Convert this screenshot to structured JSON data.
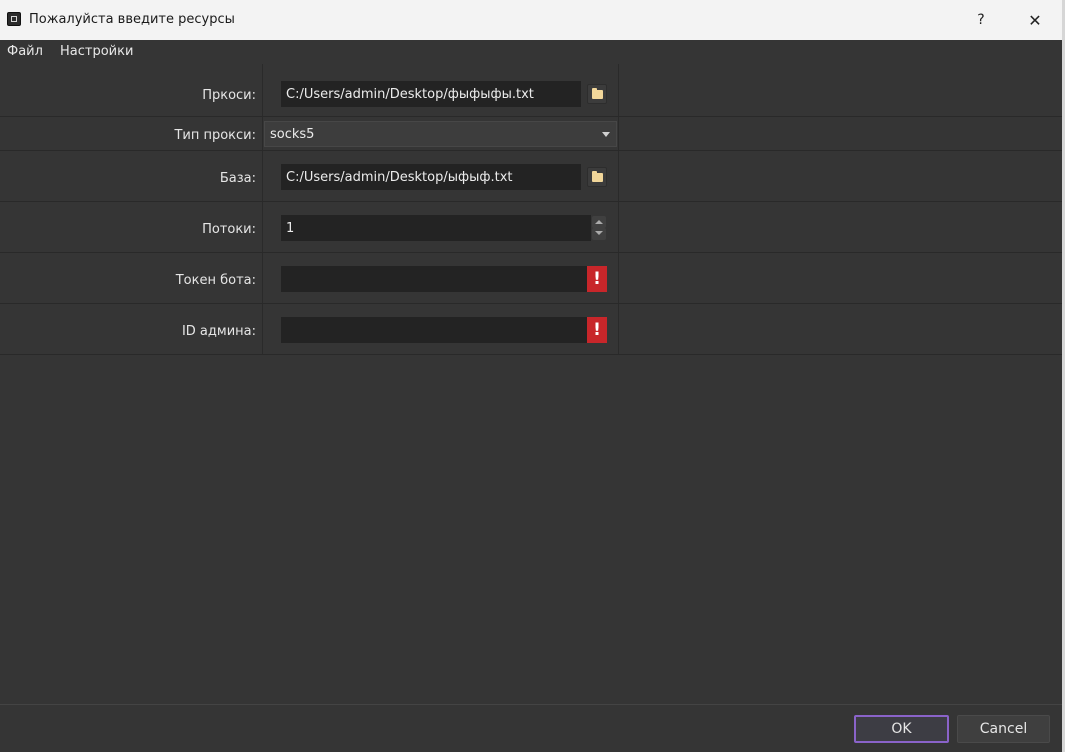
{
  "window": {
    "title": "Пожалуйста введите ресурсы",
    "help_symbol": "?",
    "close_symbol": "✕"
  },
  "menu": {
    "items": [
      "Файл",
      "Настройки"
    ]
  },
  "form": {
    "proxy": {
      "label": "Пркоси:",
      "value": "C:/Users/admin/Desktop/фыфыфы.txt"
    },
    "proxy_type": {
      "label": "Тип прокси:",
      "value": "socks5"
    },
    "base": {
      "label": "База:",
      "value": "C:/Users/admin/Desktop/ыфыф.txt"
    },
    "threads": {
      "label": "Потоки:",
      "value": "1"
    },
    "bot_token": {
      "label": "Токен бота:",
      "value": "",
      "warning": "!"
    },
    "admin_id": {
      "label": "ID админа:",
      "value": "",
      "warning": "!"
    }
  },
  "buttons": {
    "ok": "OK",
    "cancel": "Cancel"
  },
  "colors": {
    "accent": "#8a63c9",
    "warning": "#c8262a",
    "background": "#353535"
  },
  "icons": [
    "app-icon",
    "help-icon",
    "close-icon",
    "folder-icon",
    "dropdown-arrow-icon",
    "spin-up-icon",
    "spin-down-icon",
    "warning-icon"
  ]
}
